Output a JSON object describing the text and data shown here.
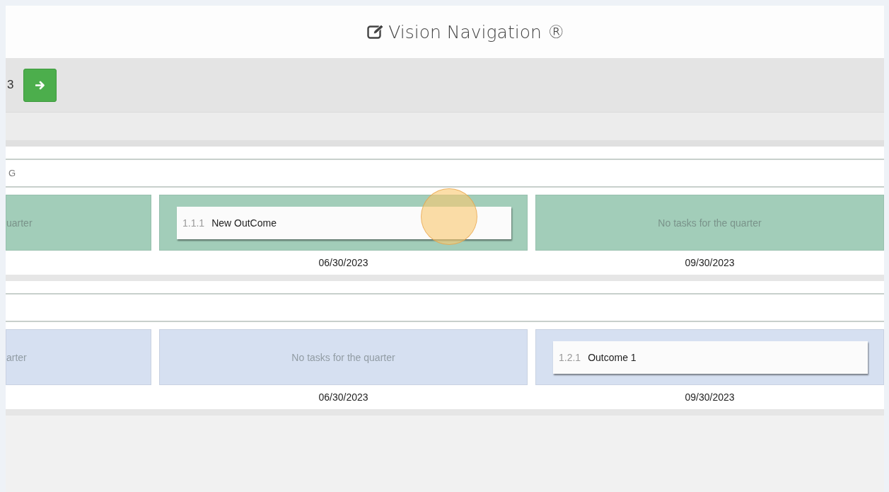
{
  "title": "Vision Navigation ®",
  "toolbar": {
    "text": "3"
  },
  "sections": [
    {
      "label": "G",
      "color": "#a2cdb9",
      "cells": [
        {
          "kind": "empty",
          "text": "uarter"
        },
        {
          "kind": "task",
          "number": "1.1.1",
          "name": "New OutCome",
          "date": "06/30/2023"
        },
        {
          "kind": "empty",
          "text": "No tasks for the quarter",
          "date": "09/30/2023"
        }
      ]
    },
    {
      "color": "#d6e0f1",
      "cells": [
        {
          "kind": "empty",
          "text": "arter"
        },
        {
          "kind": "empty",
          "text": "No tasks for the quarter",
          "date": "06/30/2023"
        },
        {
          "kind": "task",
          "number": "1.2.1",
          "name": "Outcome 1",
          "date": "09/30/2023"
        }
      ]
    }
  ]
}
